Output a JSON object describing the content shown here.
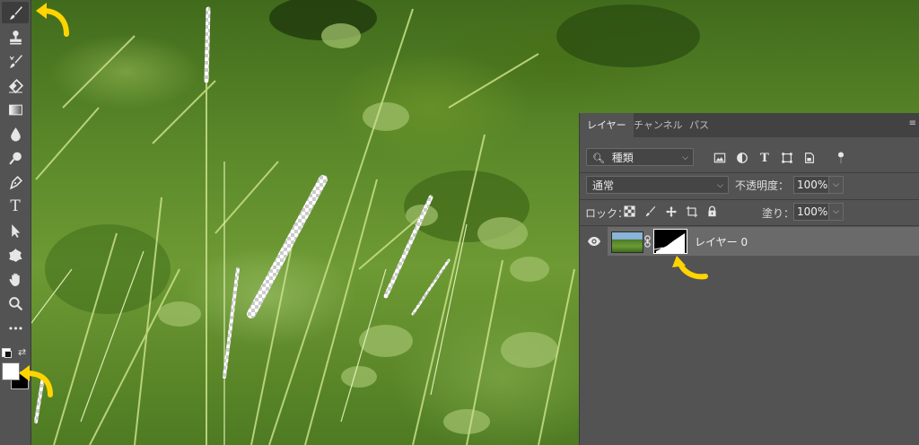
{
  "toolbar": {
    "tools": [
      {
        "name": "brush-tool",
        "icon": "brush-icon",
        "active": true
      },
      {
        "name": "clone-stamp-tool",
        "icon": "stamp-icon"
      },
      {
        "name": "history-brush-tool",
        "icon": "history-brush-icon"
      },
      {
        "name": "eraser-tool",
        "icon": "eraser-icon"
      },
      {
        "name": "gradient-tool",
        "icon": "gradient-icon"
      },
      {
        "name": "blur-tool",
        "icon": "droplet-icon"
      },
      {
        "name": "dodge-tool",
        "icon": "dodge-icon"
      },
      {
        "name": "pen-tool",
        "icon": "pen-icon"
      },
      {
        "name": "type-tool",
        "icon": "type-icon"
      },
      {
        "name": "path-selection-tool",
        "icon": "arrow-cursor-icon"
      },
      {
        "name": "custom-shape-tool",
        "icon": "shape-icon"
      },
      {
        "name": "hand-tool",
        "icon": "hand-icon"
      },
      {
        "name": "zoom-tool",
        "icon": "zoom-icon"
      },
      {
        "name": "more-tools",
        "icon": "ellipsis-icon"
      }
    ],
    "type_glyph": "T",
    "more_glyph": "•••",
    "foreground_color": "#ffffff",
    "background_color": "#000000"
  },
  "layers_panel": {
    "tabs": [
      "レイヤー",
      "チャンネル",
      "パス"
    ],
    "active_tab": "レイヤー",
    "filter": {
      "search_icon": "search-icon",
      "value": "種類"
    },
    "blend_mode": "通常",
    "opacity_label": "不透明度：",
    "opacity_value": "100%",
    "lock_label": "ロック：",
    "fill_label": "塗り：",
    "fill_value": "100%",
    "layers": [
      {
        "name": "レイヤー 0",
        "visible": true,
        "has_mask": true,
        "selected": true
      }
    ]
  },
  "colors": {
    "panel_bg": "#535353",
    "tab_bar_bg": "#424242",
    "highlight_row": "#6a6a6a",
    "annotation_arrow": "#ffd400"
  }
}
